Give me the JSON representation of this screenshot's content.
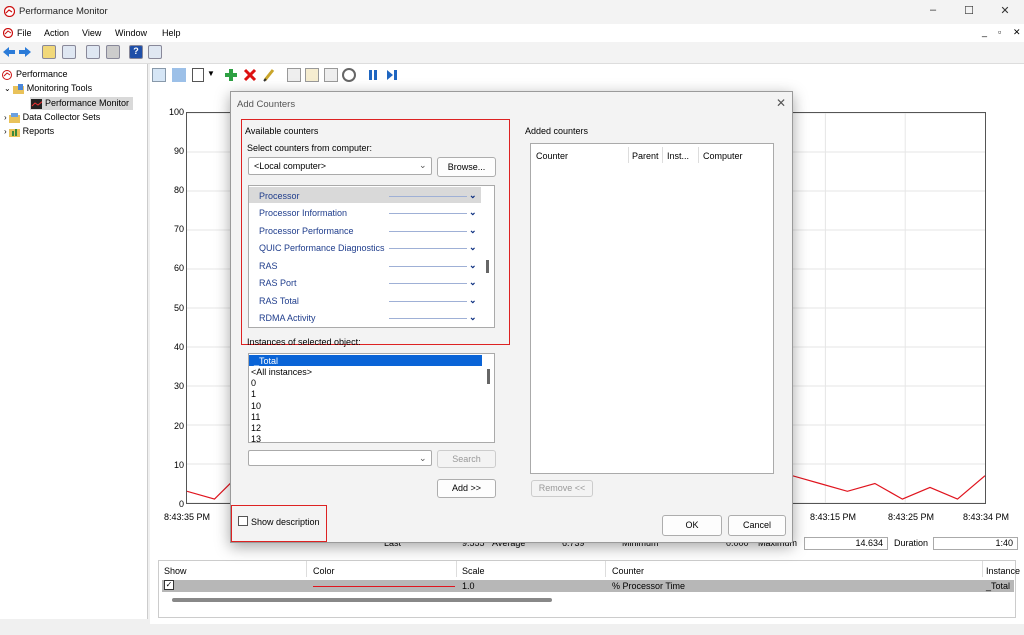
{
  "window": {
    "title": "Performance Monitor"
  },
  "menus": [
    "File",
    "Action",
    "View",
    "Window",
    "Help"
  ],
  "tree": {
    "root": "Performance",
    "monitoring_tools": "Monitoring Tools",
    "performance_monitor": "Performance Monitor",
    "data_collector_sets": "Data Collector Sets",
    "reports": "Reports"
  },
  "graph": {
    "y_ticks": [
      "100",
      "90",
      "80",
      "70",
      "60",
      "50",
      "40",
      "30",
      "20",
      "10",
      "0"
    ],
    "x_ticks": [
      "8:43:35 PM",
      "8:43:15 PM",
      "8:43:25 PM",
      "8:43:34 PM"
    ],
    "line_color": "#e0141e"
  },
  "chart_data": {
    "type": "line",
    "ylim": [
      0,
      100
    ],
    "series": [
      {
        "values": [
          3,
          1,
          8,
          10,
          4,
          8,
          5,
          1,
          null,
          3,
          8,
          6,
          9,
          15,
          9,
          3,
          6,
          7,
          6,
          8,
          7,
          4,
          7,
          5,
          3,
          5,
          1,
          4,
          1,
          7
        ]
      }
    ]
  },
  "stats": {
    "last_label": "Last",
    "last_value": "9.555",
    "average_label": "Average",
    "average_value": "6.739",
    "minimum_label": "Minimum",
    "minimum_value": "0.000",
    "maximum_label": "Maximum",
    "maximum_value": "14.634",
    "duration_label": "Duration",
    "duration_value": "1:40"
  },
  "legend": {
    "headers": [
      "Show",
      "Color",
      "Scale",
      "Counter",
      "Instance"
    ],
    "row": {
      "checked": true,
      "color": "#e0141e",
      "scale": "1.0",
      "counter": "% Processor Time",
      "instance": "_Total"
    }
  },
  "dialog": {
    "title": "Add Counters",
    "available_counters": "Available counters",
    "select_from_computer": "Select counters from computer:",
    "computer_value": "<Local computer>",
    "browse": "Browse...",
    "counters": [
      "Processor",
      "Processor Information",
      "Processor Performance",
      "QUIC Performance Diagnostics",
      "RAS",
      "RAS Port",
      "RAS Total",
      "RDMA Activity"
    ],
    "instances_label": "Instances of selected object:",
    "instances": [
      "_Total",
      "<All instances>",
      "0",
      "1",
      "10",
      "11",
      "12",
      "13"
    ],
    "search": "Search",
    "add": "Add >>",
    "added_counters": "Added counters",
    "added_headers": [
      "Counter",
      "Parent",
      "Inst...",
      "Computer"
    ],
    "remove": "Remove <<",
    "show_description": "Show description",
    "ok": "OK",
    "cancel": "Cancel"
  }
}
